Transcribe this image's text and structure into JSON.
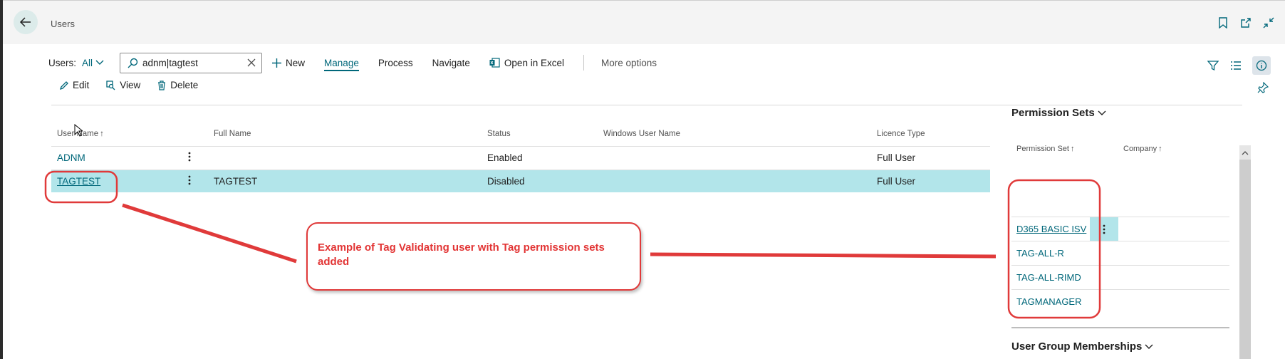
{
  "header": {
    "page_title": "Users"
  },
  "actionbar": {
    "users_label": "Users:",
    "filter_value": "All",
    "search_value": "adnm|tagtest",
    "new_label": "New",
    "manage_label": "Manage",
    "process_label": "Process",
    "navigate_label": "Navigate",
    "excel_label": "Open in Excel",
    "more_label": "More options"
  },
  "subbar": {
    "edit_label": "Edit",
    "view_label": "View",
    "delete_label": "Delete"
  },
  "table": {
    "columns": [
      "User Name",
      "Full Name",
      "Status",
      "Windows User Name",
      "Licence Type"
    ],
    "rows": [
      {
        "user_name": "ADNM",
        "full_name": "",
        "status": "Enabled",
        "windows_user_name": "",
        "licence_type": "Full User"
      },
      {
        "user_name": "TAGTEST",
        "full_name": "TAGTEST",
        "status": "Disabled",
        "windows_user_name": "",
        "licence_type": "Full User"
      }
    ]
  },
  "factbox": {
    "title": "Permission Sets",
    "columns": [
      "Permission Set",
      "Company"
    ],
    "rows": [
      {
        "permission_set": "D365 BASIC ISV",
        "company": ""
      },
      {
        "permission_set": "TAG-ALL-R",
        "company": ""
      },
      {
        "permission_set": "TAG-ALL-RIMD",
        "company": ""
      },
      {
        "permission_set": "TAGMANAGER",
        "company": ""
      }
    ],
    "title2": "User Group Memberships"
  },
  "annotation": {
    "text": "Example of Tag Validating user with Tag permission sets added",
    "color": "#e23434"
  },
  "colors": {
    "accent": "#00677a",
    "selected_row": "#b2e5ea"
  }
}
